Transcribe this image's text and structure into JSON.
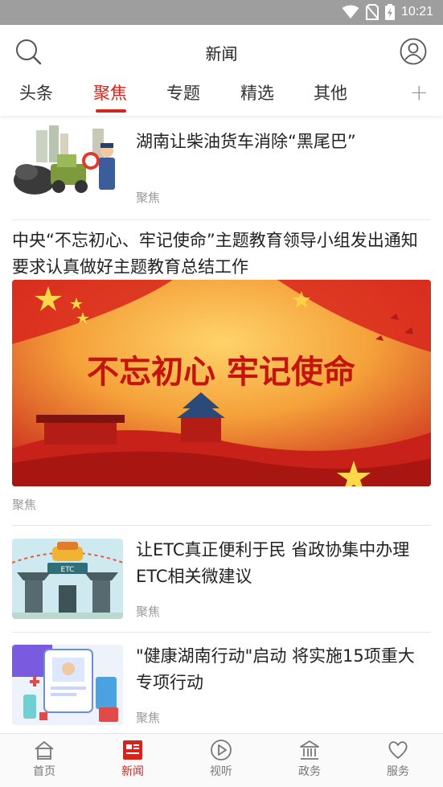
{
  "status_bar": {
    "time": "10:21",
    "icons": [
      "wifi-icon",
      "no-sim-icon",
      "battery-charging-icon"
    ]
  },
  "header": {
    "title": "新闻",
    "left_icon": "search-icon",
    "right_icon": "user-avatar-icon"
  },
  "tabs": [
    {
      "label": "头条",
      "active": false
    },
    {
      "label": "聚焦",
      "active": true
    },
    {
      "label": "专题",
      "active": false
    },
    {
      "label": "精选",
      "active": false
    },
    {
      "label": "其他",
      "active": false
    }
  ],
  "tab_add_label": "+",
  "feed": [
    {
      "headline": "湖南让柴油货车消除“黑尾巴”",
      "tag": "聚焦",
      "image": "cartoon-diesel-truck-thumbnail"
    },
    {
      "headline": "中央“不忘初心、牢记使命”主题教育领导小组发出通知 要求认真做好主题教育总结工作",
      "tag": "聚焦",
      "image": "red-banner",
      "banner_text": "不忘初心   牢记使命"
    },
    {
      "headline": "让ETC真正便利于民 省政协集中办理ETC相关微建议",
      "tag": "聚焦",
      "image": "etc-toll-gate-thumbnail"
    },
    {
      "headline": "\"健康湖南行动\"启动 将实施15项重大专项行动",
      "tag": "聚焦",
      "image": "health-illustration-thumbnail"
    }
  ],
  "bottom_nav": [
    {
      "label": "首页",
      "icon": "home-icon",
      "active": false
    },
    {
      "label": "新闻",
      "icon": "news-icon",
      "active": true
    },
    {
      "label": "视听",
      "icon": "play-icon",
      "active": false
    },
    {
      "label": "政务",
      "icon": "government-icon",
      "active": false
    },
    {
      "label": "服务",
      "icon": "heart-icon",
      "active": false
    }
  ],
  "colors": {
    "accent": "#d7231b",
    "status_bar": "#9e9e9e",
    "muted_text": "#9a9a9a"
  }
}
